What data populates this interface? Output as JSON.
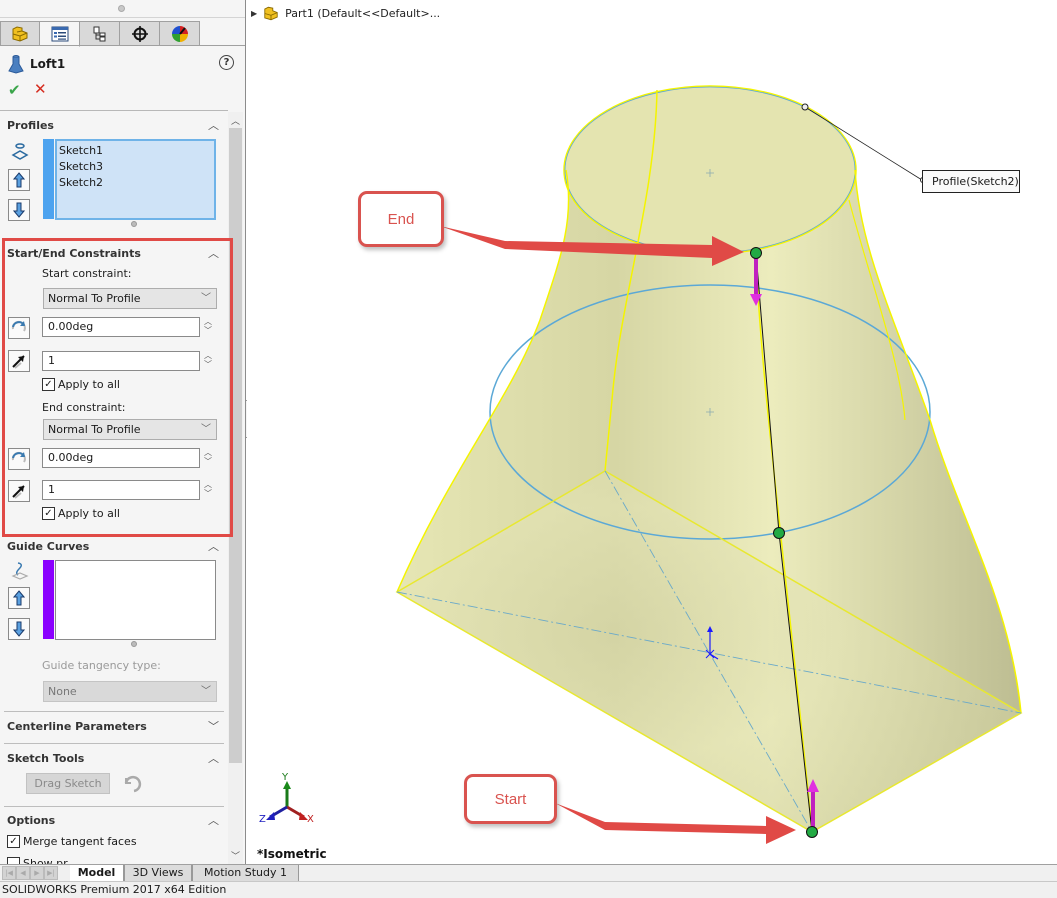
{
  "tree_flyout": {
    "part_label": "Part1  (Default<<Default>..."
  },
  "property_manager": {
    "tabs": [
      {
        "name": "feature-manager",
        "icon": "part-icon"
      },
      {
        "name": "property-manager",
        "icon": "property-list-icon",
        "active": true
      },
      {
        "name": "configuration-manager",
        "icon": "configuration-icon"
      },
      {
        "name": "dimxpert-manager",
        "icon": "crosshair-icon"
      },
      {
        "name": "display-manager",
        "icon": "appearance-icon"
      }
    ],
    "title": "Loft1",
    "help": "?",
    "ok": "✔",
    "cancel": "✕",
    "sections": {
      "profiles": {
        "title": "Profiles",
        "items": [
          "Sketch1",
          "Sketch3",
          "Sketch2"
        ],
        "accent": "#4da3ef"
      },
      "constraints": {
        "title": "Start/End Constraints",
        "start_label": "Start constraint:",
        "start_value": "Normal To Profile",
        "start_angle": "0.00deg",
        "start_tangent_length": "1",
        "start_apply_all": "Apply to all",
        "end_label": "End constraint:",
        "end_value": "Normal To Profile",
        "end_angle": "0.00deg",
        "end_tangent_length": "1",
        "end_apply_all": "Apply to all"
      },
      "guide_curves": {
        "title": "Guide Curves",
        "tangency_label": "Guide tangency type:",
        "tangency_value": "None",
        "accent": "#8b00ff"
      },
      "centerline": {
        "title": "Centerline Parameters"
      },
      "sketch_tools": {
        "title": "Sketch Tools",
        "drag_sketch": "Drag Sketch"
      },
      "options": {
        "title": "Options",
        "merge_tangent": "Merge tangent faces",
        "show_preview_partial": "Show pr..."
      }
    }
  },
  "viewport": {
    "callouts": {
      "end": "End",
      "start": "Start"
    },
    "profile_tag": "Profile(Sketch2)",
    "view_label": "*Isometric",
    "triad": {
      "x": "X",
      "y": "Y",
      "z": "Z"
    },
    "colors": {
      "face": "#e6e6b4",
      "edge": "#f4f400",
      "sketch": "#5ba8d6",
      "connector": "#22aa44",
      "handle": "#d020d0",
      "callout": "#d9534f"
    }
  },
  "bottom_tabs": [
    {
      "label": "Model",
      "active": true
    },
    {
      "label": "3D Views"
    },
    {
      "label": "Motion Study 1"
    }
  ],
  "status_bar": {
    "text": "SOLIDWORKS Premium 2017 x64 Edition"
  }
}
